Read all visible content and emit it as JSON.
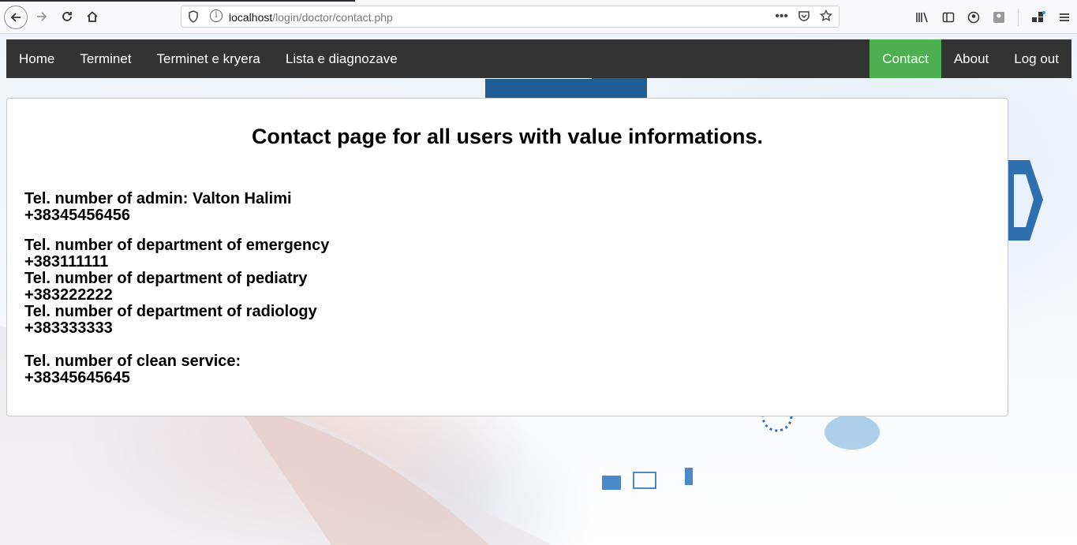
{
  "browser": {
    "url_host": "localhost",
    "url_path": "/login/doctor/contact.php"
  },
  "nav": {
    "left": [
      {
        "label": "Home"
      },
      {
        "label": "Terminet"
      },
      {
        "label": "Terminet e kryera"
      },
      {
        "label": "Lista e diagnozave"
      }
    ],
    "right": [
      {
        "label": "Contact",
        "active": true
      },
      {
        "label": "About"
      },
      {
        "label": "Log out"
      }
    ],
    "bg_color": "#333333",
    "active_color": "#4caf50"
  },
  "content": {
    "heading": "Contact page for all users with value informations.",
    "admin_label": "Tel. number of admin: Valton Halimi",
    "admin_phone": "+38345456456",
    "emergency_label": "Tel. number of department of emergency",
    "emergency_phone": "+383111111",
    "pediatry_label": "Tel. number of department of pediatry",
    "pediatry_phone": "+383222222",
    "radiology_label": "Tel. number of department of radiology",
    "radiology_phone": "+383333333",
    "clean_label": "Tel. number of clean service:",
    "clean_phone": "+38345645645"
  }
}
